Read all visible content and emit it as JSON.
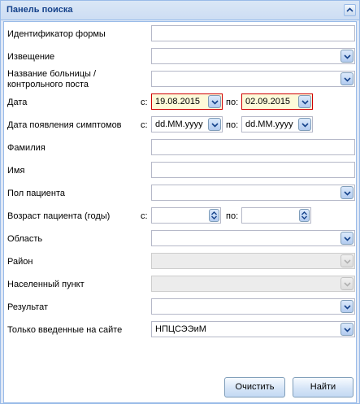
{
  "panel": {
    "title": "Панель поиска"
  },
  "form": {
    "form_id": {
      "label": "Идентификатор формы",
      "value": ""
    },
    "notice": {
      "label": "Извещение",
      "value": ""
    },
    "hospital": {
      "label_line1": "Название больницы /",
      "label_line2": "контрольного поста",
      "value": ""
    },
    "date": {
      "label": "Дата",
      "from_label": "с:",
      "from_value": "19.08.2015",
      "to_label": "по:",
      "to_value": "02.09.2015"
    },
    "symptom_date": {
      "label": "Дата появления симптомов",
      "from_label": "с:",
      "from_value": "dd.MM.yyyy",
      "to_label": "по:",
      "to_value": "dd.MM.yyyy"
    },
    "surname": {
      "label": "Фамилия",
      "value": ""
    },
    "name": {
      "label": "Имя",
      "value": ""
    },
    "sex": {
      "label": "Пол пациента",
      "value": ""
    },
    "age": {
      "label": "Возраст пациента (годы)",
      "from_label": "с:",
      "from_value": "",
      "to_label": "по:",
      "to_value": ""
    },
    "region": {
      "label": "Область",
      "value": ""
    },
    "district": {
      "label": "Район",
      "value": ""
    },
    "locality": {
      "label": "Населенный пункт",
      "value": ""
    },
    "result": {
      "label": "Результат",
      "value": ""
    },
    "site_only": {
      "label": "Только введенные на сайте",
      "value": "НПЦСЭЭиМ"
    }
  },
  "buttons": {
    "clear": "Очистить",
    "find": "Найти"
  },
  "colors": {
    "header_text": "#15428b",
    "border": "#99bbe8",
    "date_highlight_border": "#d00000",
    "date_highlight_bg": "#fdfad9"
  },
  "icons": {
    "collapse": "chevron-up-icon",
    "combo_trigger": "chevron-down-icon",
    "date_trigger": "calendar-icon",
    "spinner_trigger": "spinner-icon"
  }
}
